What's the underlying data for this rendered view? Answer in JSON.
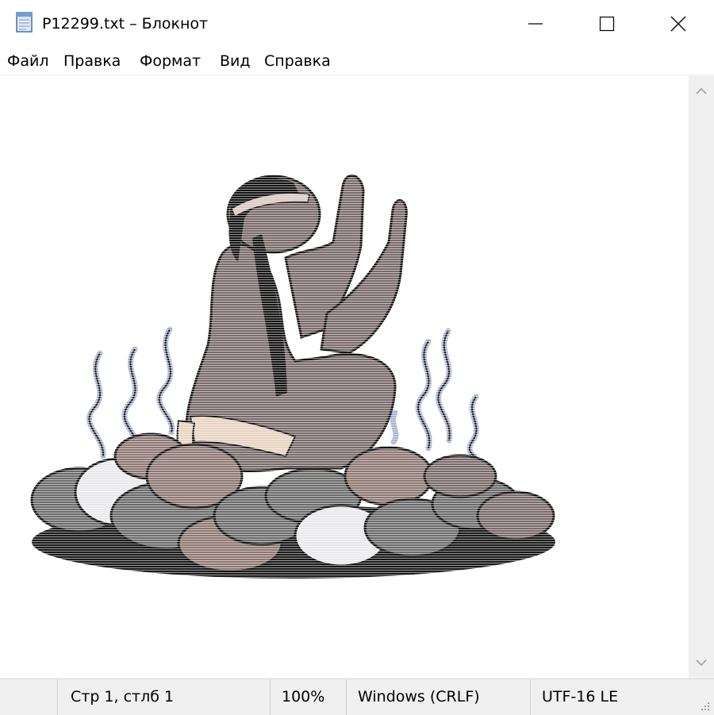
{
  "window": {
    "title": "P12299.txt – Блокнот",
    "app_icon": "notepad-icon",
    "controls": [
      "minimize-icon",
      "maximize-icon",
      "close-icon"
    ]
  },
  "menu": {
    "items": [
      {
        "label": "Файл"
      },
      {
        "label": "Правка"
      },
      {
        "label": "Формат"
      },
      {
        "label": "Вид"
      },
      {
        "label": "Справка"
      }
    ]
  },
  "editor": {
    "content": "ASCII-art illustration rendered in colored text: kneeling figure with raised hands among rocks and rising steam",
    "colors": {
      "skin": "#7a6a6a",
      "hair": "#141414",
      "rock_dark": "#6b6b6b",
      "rock_light": "#e9e9ec",
      "rock_brown": "#8e7873",
      "steam": "#a9b3cf",
      "cloth": "#e7d2c0"
    }
  },
  "statusbar": {
    "position": "Стр 1, стлб 1",
    "zoom": "100%",
    "line_endings": "Windows (CRLF)",
    "encoding": "UTF-16 LE"
  }
}
